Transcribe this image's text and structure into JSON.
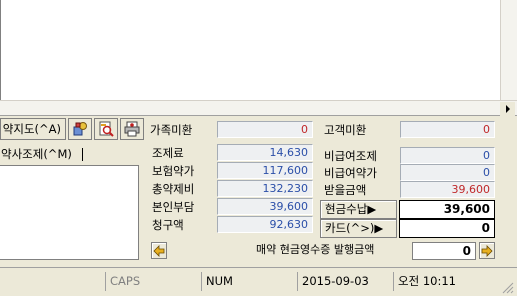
{
  "tabs": {
    "rx_map_label": "약지도(^A)",
    "pharmacist_label": "약사조제(^M)"
  },
  "toolbar_icons": [
    "medicine-icon",
    "search-document-icon",
    "printer-stamp-icon"
  ],
  "family_unpaid": {
    "label": "가족미환",
    "value": "0"
  },
  "customer_unpaid": {
    "label": "고객미환",
    "value": "0"
  },
  "left_fields": [
    {
      "label": "조제료",
      "value": "14,630"
    },
    {
      "label": "보험약가",
      "value": "117,600"
    },
    {
      "label": "총약제비",
      "value": "132,230"
    },
    {
      "label": "본인부담",
      "value": "39,600"
    },
    {
      "label": "청구액",
      "value": "92,630"
    }
  ],
  "right_fields": [
    {
      "label": "비급여조제",
      "value": "0"
    },
    {
      "label": "비급여약가",
      "value": "0"
    },
    {
      "label": "받을금액",
      "value": "39,600"
    }
  ],
  "payment": {
    "cash_label": "현금수납▶",
    "cash_value": "39,600",
    "card_label": "카드(^>)▶",
    "card_value": "0"
  },
  "receipt": {
    "label": "매약 현금영수증 발행금액",
    "value": "0"
  },
  "statusbar": {
    "caps": "CAPS",
    "num": "NUM",
    "date": "2015-09-03",
    "time": "오전 10:11"
  },
  "colors": {
    "blue_value": "#2b4fa8",
    "red_value": "#c0282a",
    "panel_bg": "#ece9d8"
  }
}
